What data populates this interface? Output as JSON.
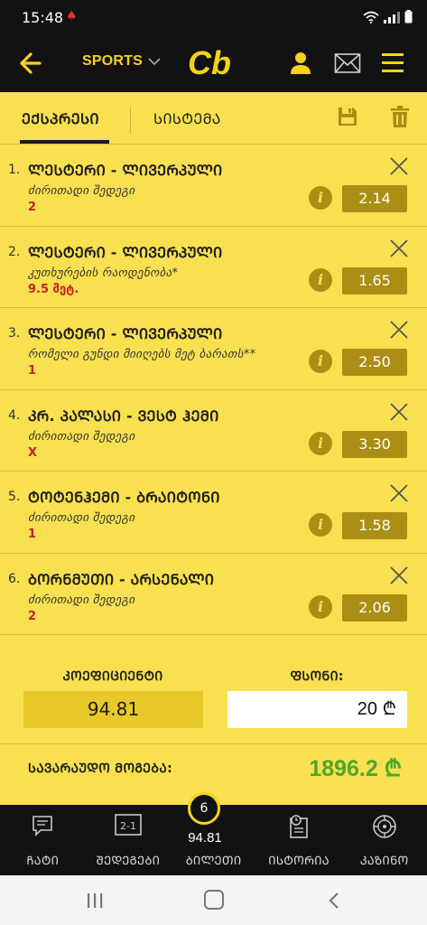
{
  "status_bar": {
    "time": "15:48"
  },
  "header": {
    "menu_label": "SPORTS",
    "logo_text": "Cb"
  },
  "tabs": {
    "express": "ᲔᲥᲡᲞᲠᲔᲡᲘ",
    "system": "ᲡᲘᲡᲢᲔᲛᲐ"
  },
  "bets": [
    {
      "num": "1.",
      "match": "ᲚᲔᲡᲢᲔᲠᲘ - ᲚᲘᲕᲔᲠᲞᲣᲚᲘ",
      "market": "ძირითადი შედეგი",
      "selection": "2",
      "odd": "2.14"
    },
    {
      "num": "2.",
      "match": "ᲚᲔᲡᲢᲔᲠᲘ - ᲚᲘᲕᲔᲠᲞᲣᲚᲘ",
      "market": "კუთხურების რაოდენობა*",
      "selection": "9.5 მეტ.",
      "odd": "1.65"
    },
    {
      "num": "3.",
      "match": "ᲚᲔᲡᲢᲔᲠᲘ - ᲚᲘᲕᲔᲠᲞᲣᲚᲘ",
      "market": "რომელი გუნდი მიიღებს მეტ ბარათს**",
      "selection": "1",
      "odd": "2.50"
    },
    {
      "num": "4.",
      "match": "ᲙᲠ. ᲞᲐᲚᲐᲡᲘ - ᲕᲔᲡᲢ ᲰᲔᲛᲘ",
      "market": "ძირითადი შედეგი",
      "selection": "X",
      "odd": "3.30"
    },
    {
      "num": "5.",
      "match": "ᲢᲝᲢᲔᲜᲰᲔᲛᲘ - ᲑᲠᲐᲘᲢᲝᲜᲘ",
      "market": "ძირითადი შედეგი",
      "selection": "1",
      "odd": "1.58"
    },
    {
      "num": "6.",
      "match": "ᲑᲝᲠᲜᲛᲣᲗᲘ - ᲐᲠᲡᲔᲜᲐᲚᲘ",
      "market": "ძირითადი შედეგი",
      "selection": "2",
      "odd": "2.06"
    }
  ],
  "summary": {
    "coefficient_label": "ᲙᲝᲔᲤᲘᲪᲘᲔᲜᲢᲘ",
    "coefficient_value": "94.81",
    "stake_label": "ᲤᲡᲝᲜᲘ:",
    "stake_value": "20 ₾",
    "potential_win_label": "ᲡᲐᲕᲐᲠᲐᲣᲓᲝ ᲛᲝᲒᲔᲑᲐ:",
    "potential_win_value": "1896.2 ₾"
  },
  "bottom_nav": {
    "items": [
      {
        "label": "ᲩᲐᲢᲘ",
        "icon": "chat-icon"
      },
      {
        "label": "ᲨᲔᲓᲔᲒᲔᲑᲘ",
        "icon": "results-icon",
        "icon_text": "2-1"
      },
      {
        "label": "ᲑᲘᲚᲔᲗᲘ",
        "icon": "betslip-icon"
      },
      {
        "label": "ᲘᲡᲢᲝᲠᲘᲐ",
        "icon": "history-icon"
      },
      {
        "label": "ᲙᲐᲖᲘᲜᲝ",
        "icon": "casino-icon"
      }
    ],
    "bet_count": "6",
    "bet_total": "94.81"
  },
  "colors": {
    "accent": "#f9e051",
    "odd_box": "#ab8f14",
    "win_green": "#4da72d",
    "dark": "#121212"
  }
}
